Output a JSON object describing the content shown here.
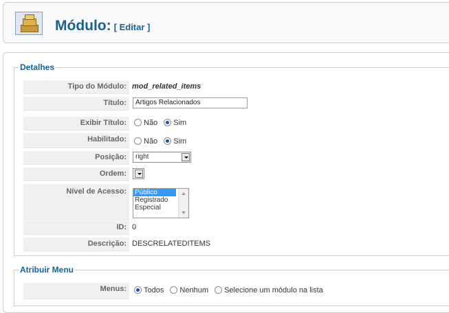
{
  "header": {
    "title": "Módulo:",
    "subtitle": "[ Editar ]"
  },
  "details": {
    "legend": "Detalhes",
    "module_type": {
      "label": "Tipo do Módulo:",
      "value": "mod_related_items"
    },
    "title_field": {
      "label": "Título:",
      "value": "Artigos Relacionados"
    },
    "show_title": {
      "label": "Exibir Título:",
      "options": [
        "Não",
        "Sim"
      ],
      "selected": "Sim"
    },
    "enabled": {
      "label": "Habilitado:",
      "options": [
        "Não",
        "Sim"
      ],
      "selected": "Sim"
    },
    "position": {
      "label": "Posição:",
      "value": "right"
    },
    "order": {
      "label": "Ordem:",
      "value": ""
    },
    "access_level": {
      "label": "Nível de Acesso:",
      "options": [
        "Público",
        "Registrado",
        "Especial"
      ],
      "selected": "Público"
    },
    "id": {
      "label": "ID:",
      "value": "0"
    },
    "description": {
      "label": "Descrição:",
      "value": "DESCRELATEDITEMS"
    }
  },
  "menu": {
    "legend": "Atribuir Menu",
    "menus": {
      "label": "Menus:",
      "options": [
        "Todos",
        "Nenhum",
        "Selecione um módulo na lista"
      ],
      "selected": "Todos"
    }
  },
  "colors": {
    "title_blue": "#146295",
    "label_bg": "#f0f0f0",
    "selection_blue": "#3399ff"
  },
  "icons": {
    "module_icon": "module-stack-icon"
  }
}
